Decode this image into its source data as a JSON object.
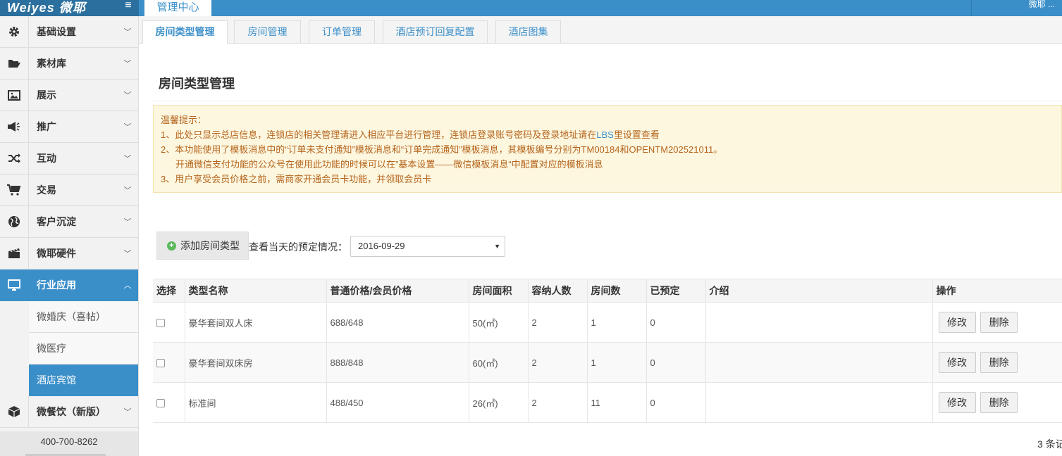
{
  "topbar": {
    "logo": "Weiyes 微耶",
    "module_tab": "管理中心",
    "user": "微耶 ..."
  },
  "sidebar": {
    "items": [
      {
        "label": "基础设置",
        "icon": "gear-icon"
      },
      {
        "label": "素材库",
        "icon": "folder-open-icon"
      },
      {
        "label": "展示",
        "icon": "image-icon"
      },
      {
        "label": "推广",
        "icon": "megaphone-icon"
      },
      {
        "label": "互动",
        "icon": "shuffle-icon"
      },
      {
        "label": "交易",
        "icon": "shopping-cart-icon"
      },
      {
        "label": "客户沉淀",
        "icon": "globe-icon"
      },
      {
        "label": "微耶硬件",
        "icon": "film-clapper-icon"
      },
      {
        "label": "行业应用",
        "icon": "monitor-icon"
      }
    ],
    "sub_items": [
      "微婚庆（喜帖）",
      "微医疗",
      "酒店宾馆"
    ],
    "last_item": {
      "label": "微餐饮（新版）",
      "icon": "cube-icon"
    },
    "phone": "400-700-8262"
  },
  "tabs": [
    "房间类型管理",
    "房间管理",
    "订单管理",
    "酒店预订回复配置",
    "酒店图集"
  ],
  "page_title": "房间类型管理",
  "notice": {
    "heading": "温馨提示：",
    "line1_pre": "1、此处只显示总店信息，连锁店的相关管理请进入相应平台进行管理，连锁店登录账号密码及登录地址请在",
    "line1_link": "LBS",
    "line1_post": "里设置查看",
    "line2": "2、本功能使用了模板消息中的“订单未支付通知”模板消息和“订单完成通知”模板消息，其模板编号分别为TM00184和OPENTM202521011。",
    "line2b": "开通微信支付功能的公众号在使用此功能的时候可以在”基本设置——微信模板消息“中配置对应的模板消息",
    "line3": "3、用户享受会员价格之前，需商家开通会员卡功能，并领取会员卡"
  },
  "toolbar": {
    "add_label": "添加房间类型",
    "date_label": "查看当天的预定情况：",
    "date_value": "2016-09-29"
  },
  "table": {
    "headers": [
      "选择",
      "类型名称",
      "普通价格/会员价格",
      "房间面积",
      "容纳人数",
      "房间数",
      "已预定",
      "介绍",
      "操作"
    ],
    "rows": [
      {
        "name": "豪华套间双人床",
        "price": "688/648",
        "area": "50(㎡)",
        "capacity": "2",
        "rooms": "1",
        "booked": "0",
        "intro": ""
      },
      {
        "name": "豪华套间双床房",
        "price": "888/848",
        "area": "60(㎡)",
        "capacity": "2",
        "rooms": "1",
        "booked": "0",
        "intro": ""
      },
      {
        "name": "标准间",
        "price": "488/450",
        "area": "26(㎡)",
        "capacity": "2",
        "rooms": "11",
        "booked": "0",
        "intro": ""
      }
    ],
    "edit_label": "修改",
    "delete_label": "删除"
  },
  "pager": {
    "count": "3 条记"
  }
}
